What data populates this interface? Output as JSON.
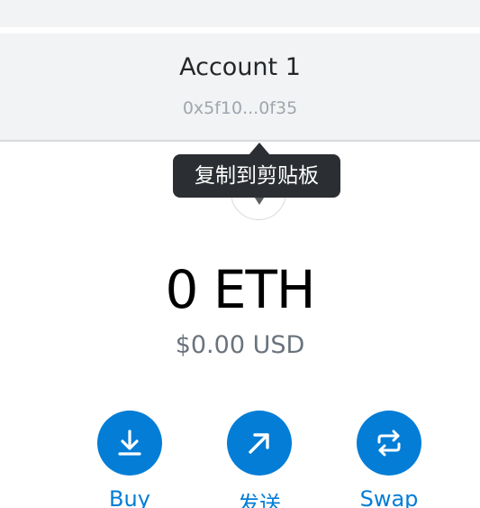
{
  "account": {
    "name": "Account 1",
    "address": "0x5f10...0f35"
  },
  "tooltip": {
    "text": "复制到剪贴板"
  },
  "balance": {
    "amount": "0 ETH",
    "fiat": "$0.00 USD"
  },
  "actions": {
    "buy_label": "Buy",
    "send_label": "发送",
    "swap_label": "Swap"
  },
  "icons": {
    "buy": "download-icon",
    "send": "arrow-up-right-icon",
    "swap": "swap-icon",
    "token": "eth-icon"
  },
  "colors": {
    "accent": "#037dd6",
    "header_bg": "#f2f3f4",
    "tooltip_bg": "#2b2e32",
    "muted_text": "#6a737d"
  }
}
